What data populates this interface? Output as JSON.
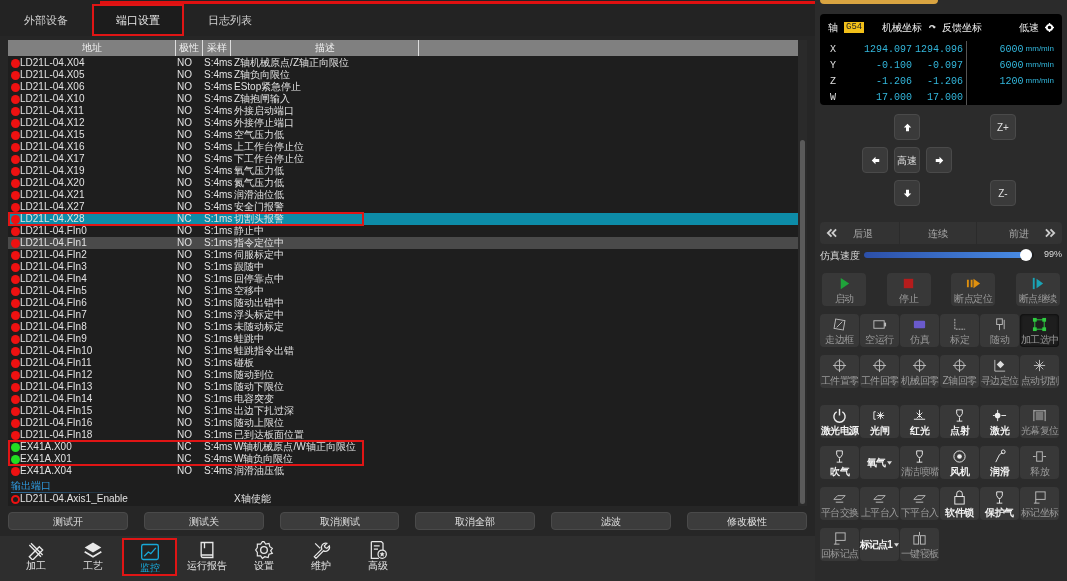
{
  "tabs": [
    {
      "label": "外部设备",
      "selected": false
    },
    {
      "label": "端口设置",
      "selected": true
    },
    {
      "label": "日志列表",
      "selected": false
    }
  ],
  "table": {
    "columns": [
      "地址",
      "极性",
      "采样",
      "描述"
    ],
    "rows": [
      {
        "kind": "input",
        "address": "LD21L-04.X04",
        "polarity": "NO",
        "sample": "S:4ms",
        "description": "Z轴机械原点/Z轴正向限位",
        "on": false,
        "selected": false,
        "hovered": false,
        "outlined": false
      },
      {
        "kind": "input",
        "address": "LD21L-04.X05",
        "polarity": "NO",
        "sample": "S:4ms",
        "description": "Z轴负向限位",
        "on": false,
        "selected": false,
        "hovered": false,
        "outlined": false
      },
      {
        "kind": "input",
        "address": "LD21L-04.X06",
        "polarity": "NO",
        "sample": "S:4ms",
        "description": "EStop紧急停止",
        "on": false,
        "selected": false,
        "hovered": false,
        "outlined": false
      },
      {
        "kind": "input",
        "address": "LD21L-04.X10",
        "polarity": "NO",
        "sample": "S:4ms",
        "description": "Z轴抱闸输入",
        "on": false,
        "selected": false,
        "hovered": false,
        "outlined": false
      },
      {
        "kind": "input",
        "address": "LD21L-04.X11",
        "polarity": "NO",
        "sample": "S:4ms",
        "description": "外接启动端口",
        "on": false,
        "selected": false,
        "hovered": false,
        "outlined": false
      },
      {
        "kind": "input",
        "address": "LD21L-04.X12",
        "polarity": "NO",
        "sample": "S:4ms",
        "description": "外接停止端口",
        "on": false,
        "selected": false,
        "hovered": false,
        "outlined": false
      },
      {
        "kind": "input",
        "address": "LD21L-04.X15",
        "polarity": "NO",
        "sample": "S:4ms",
        "description": "空气压力低",
        "on": false,
        "selected": false,
        "hovered": false,
        "outlined": false
      },
      {
        "kind": "input",
        "address": "LD21L-04.X16",
        "polarity": "NO",
        "sample": "S:4ms",
        "description": "上工作台停止位",
        "on": false,
        "selected": false,
        "hovered": false,
        "outlined": false
      },
      {
        "kind": "input",
        "address": "LD21L-04.X17",
        "polarity": "NO",
        "sample": "S:4ms",
        "description": "下工作台停止位",
        "on": false,
        "selected": false,
        "hovered": false,
        "outlined": false
      },
      {
        "kind": "input",
        "address": "LD21L-04.X19",
        "polarity": "NO",
        "sample": "S:4ms",
        "description": "氧气压力低",
        "on": false,
        "selected": false,
        "hovered": false,
        "outlined": false
      },
      {
        "kind": "input",
        "address": "LD21L-04.X20",
        "polarity": "NO",
        "sample": "S:4ms",
        "description": "氮气压力低",
        "on": false,
        "selected": false,
        "hovered": false,
        "outlined": false
      },
      {
        "kind": "input",
        "address": "LD21L-04.X21",
        "polarity": "NO",
        "sample": "S:4ms",
        "description": "润滑油位低",
        "on": false,
        "selected": false,
        "hovered": false,
        "outlined": false
      },
      {
        "kind": "input",
        "address": "LD21L-04.X27",
        "polarity": "NO",
        "sample": "S:4ms",
        "description": "安全门报警",
        "on": false,
        "selected": false,
        "hovered": false,
        "outlined": false
      },
      {
        "kind": "input",
        "address": "LD21L-04.X28",
        "polarity": "NC",
        "sample": "S:1ms",
        "description": "切割头报警",
        "on": false,
        "selected": true,
        "hovered": false,
        "outlined": true
      },
      {
        "kind": "input",
        "address": "LD21L-04.FIn0",
        "polarity": "NO",
        "sample": "S:1ms",
        "description": "静止中",
        "on": false,
        "selected": false,
        "hovered": false,
        "outlined": false
      },
      {
        "kind": "input",
        "address": "LD21L-04.FIn1",
        "polarity": "NO",
        "sample": "S:1ms",
        "description": "指令定位中",
        "on": false,
        "selected": false,
        "hovered": true,
        "outlined": false
      },
      {
        "kind": "input",
        "address": "LD21L-04.FIn2",
        "polarity": "NO",
        "sample": "S:1ms",
        "description": "伺服标定中",
        "on": false,
        "selected": false,
        "hovered": false,
        "outlined": false
      },
      {
        "kind": "input",
        "address": "LD21L-04.FIn3",
        "polarity": "NO",
        "sample": "S:1ms",
        "description": "跟随中",
        "on": false,
        "selected": false,
        "hovered": false,
        "outlined": false
      },
      {
        "kind": "input",
        "address": "LD21L-04.FIn4",
        "polarity": "NO",
        "sample": "S:1ms",
        "description": "回停靠点中",
        "on": false,
        "selected": false,
        "hovered": false,
        "outlined": false
      },
      {
        "kind": "input",
        "address": "LD21L-04.FIn5",
        "polarity": "NO",
        "sample": "S:1ms",
        "description": "空移中",
        "on": false,
        "selected": false,
        "hovered": false,
        "outlined": false
      },
      {
        "kind": "input",
        "address": "LD21L-04.FIn6",
        "polarity": "NO",
        "sample": "S:1ms",
        "description": "随动出错中",
        "on": false,
        "selected": false,
        "hovered": false,
        "outlined": false
      },
      {
        "kind": "input",
        "address": "LD21L-04.FIn7",
        "polarity": "NO",
        "sample": "S:1ms",
        "description": "浮头标定中",
        "on": false,
        "selected": false,
        "hovered": false,
        "outlined": false
      },
      {
        "kind": "input",
        "address": "LD21L-04.FIn8",
        "polarity": "NO",
        "sample": "S:1ms",
        "description": "未随动标定",
        "on": false,
        "selected": false,
        "hovered": false,
        "outlined": false
      },
      {
        "kind": "input",
        "address": "LD21L-04.FIn9",
        "polarity": "NO",
        "sample": "S:1ms",
        "description": "蛙跳中",
        "on": false,
        "selected": false,
        "hovered": false,
        "outlined": false
      },
      {
        "kind": "input",
        "address": "LD21L-04.FIn10",
        "polarity": "NO",
        "sample": "S:1ms",
        "description": "蛙跳指令出错",
        "on": false,
        "selected": false,
        "hovered": false,
        "outlined": false
      },
      {
        "kind": "input",
        "address": "LD21L-04.FIn11",
        "polarity": "NO",
        "sample": "S:1ms",
        "description": "碰板",
        "on": false,
        "selected": false,
        "hovered": false,
        "outlined": false
      },
      {
        "kind": "input",
        "address": "LD21L-04.FIn12",
        "polarity": "NO",
        "sample": "S:1ms",
        "description": "随动到位",
        "on": false,
        "selected": false,
        "hovered": false,
        "outlined": false
      },
      {
        "kind": "input",
        "address": "LD21L-04.FIn13",
        "polarity": "NO",
        "sample": "S:1ms",
        "description": "随动下限位",
        "on": false,
        "selected": false,
        "hovered": false,
        "outlined": false
      },
      {
        "kind": "input",
        "address": "LD21L-04.FIn14",
        "polarity": "NO",
        "sample": "S:1ms",
        "description": "电容突变",
        "on": false,
        "selected": false,
        "hovered": false,
        "outlined": false
      },
      {
        "kind": "input",
        "address": "LD21L-04.FIn15",
        "polarity": "NO",
        "sample": "S:1ms",
        "description": "出边下扎过深",
        "on": false,
        "selected": false,
        "hovered": false,
        "outlined": false
      },
      {
        "kind": "input",
        "address": "LD21L-04.FIn16",
        "polarity": "NO",
        "sample": "S:1ms",
        "description": "随动上限位",
        "on": false,
        "selected": false,
        "hovered": false,
        "outlined": false
      },
      {
        "kind": "input",
        "address": "LD21L-04.FIn18",
        "polarity": "NO",
        "sample": "S:1ms",
        "description": "已到达板面位置",
        "on": false,
        "selected": false,
        "hovered": false,
        "outlined": false
      },
      {
        "kind": "input",
        "address": "EX41A.X00",
        "polarity": "NC",
        "sample": "S:4ms",
        "description": "W轴机械原点/W轴正向限位",
        "on": true,
        "selected": false,
        "hovered": false,
        "outlined": true
      },
      {
        "kind": "input",
        "address": "EX41A.X01",
        "polarity": "NC",
        "sample": "S:4ms",
        "description": "W轴负向限位",
        "on": true,
        "selected": false,
        "hovered": false,
        "outlined": true
      },
      {
        "kind": "input",
        "address": "EX41A.X04",
        "polarity": "NO",
        "sample": "S:4ms",
        "description": "润滑油压低",
        "on": false,
        "selected": false,
        "hovered": false,
        "outlined": false
      },
      {
        "kind": "section",
        "label": "输出端口"
      },
      {
        "kind": "output",
        "address": "LD21L-04.Axis1_Enable",
        "description": "X轴使能",
        "on": false,
        "selected": false,
        "hovered": false,
        "outlined": false
      }
    ]
  },
  "actions": [
    "测试开",
    "测试关",
    "取消测试",
    "取消全部",
    "滤波",
    "修改极性"
  ],
  "nav": [
    {
      "label": "加工",
      "selected": false
    },
    {
      "label": "工艺",
      "selected": false
    },
    {
      "label": "监控",
      "selected": true
    },
    {
      "label": "运行报告",
      "selected": false
    },
    {
      "label": "设置",
      "selected": false
    },
    {
      "label": "维护",
      "selected": false
    },
    {
      "label": "高级",
      "selected": false
    }
  ],
  "dro": {
    "axis_label": "轴",
    "offset": "G54",
    "machine_label": "机械坐标",
    "feedback_label": "反馈坐标",
    "speed_mode": "低速",
    "rows": [
      {
        "axis": "X",
        "machine": "1294.097",
        "feedback": "1294.096",
        "speed": "6000",
        "unit": "mm/min"
      },
      {
        "axis": "Y",
        "machine": "-0.100",
        "feedback": "-0.097",
        "speed": "6000",
        "unit": "mm/min"
      },
      {
        "axis": "Z",
        "machine": "-1.206",
        "feedback": "-1.206",
        "speed": "1200",
        "unit": "mm/min"
      },
      {
        "axis": "W",
        "machine": "17.000",
        "feedback": "17.000"
      }
    ]
  },
  "jog": {
    "speed": "高速",
    "z_up": "Z+",
    "z_down": "Z-"
  },
  "step": {
    "back": "后退",
    "continuous": "连续",
    "forward": "前进"
  },
  "sim_speed": {
    "label": "仿真速度",
    "level": 0.99,
    "reading": "99%"
  },
  "button_groups": [
    {
      "buttons": [
        {
          "kind": "button",
          "label": "启动",
          "disabled": true,
          "on": false
        },
        {
          "kind": "button",
          "label": "停止",
          "disabled": true,
          "on": false
        },
        {
          "kind": "button",
          "label": "断点定位",
          "disabled": true,
          "on": false
        },
        {
          "kind": "button",
          "label": "断点继续",
          "disabled": true,
          "on": false
        }
      ]
    },
    {
      "buttons": [
        {
          "kind": "button",
          "label": "走边框",
          "disabled": true,
          "on": false
        },
        {
          "kind": "button",
          "label": "空运行",
          "disabled": true,
          "on": false
        },
        {
          "kind": "button",
          "label": "仿真",
          "disabled": true,
          "on": false
        },
        {
          "kind": "button",
          "label": "标定",
          "disabled": true,
          "on": false
        },
        {
          "kind": "button",
          "label": "随动",
          "disabled": true,
          "on": false
        },
        {
          "kind": "button",
          "label": "加工选中",
          "disabled": true,
          "on": true
        },
        {
          "kind": "button",
          "label": "工件置零",
          "disabled": true,
          "on": false
        },
        {
          "kind": "button",
          "label": "工件回零",
          "disabled": true,
          "on": false
        },
        {
          "kind": "button",
          "label": "机械回零",
          "disabled": true,
          "on": false
        },
        {
          "kind": "button",
          "label": "Z轴回零",
          "disabled": true,
          "on": false
        },
        {
          "kind": "button",
          "label": "寻边定位",
          "disabled": true,
          "on": false
        },
        {
          "kind": "button",
          "label": "点动切割",
          "disabled": true,
          "on": false
        }
      ]
    },
    {
      "buttons": [
        {
          "kind": "button",
          "label": "激光电源",
          "disabled": false,
          "on": false
        },
        {
          "kind": "button",
          "label": "光闸",
          "disabled": false,
          "on": false
        },
        {
          "kind": "button",
          "label": "红光",
          "disabled": false,
          "on": false
        },
        {
          "kind": "button",
          "label": "点射",
          "disabled": false,
          "on": false
        },
        {
          "kind": "button",
          "label": "激光",
          "disabled": false,
          "on": false
        },
        {
          "kind": "button",
          "label": "光幕复位",
          "disabled": true,
          "on": false
        },
        {
          "kind": "button",
          "label": "吹气",
          "disabled": false,
          "on": false
        },
        {
          "kind": "dropdown",
          "label": "氧气",
          "disabled": false,
          "on": false
        },
        {
          "kind": "button",
          "label": "清洁喷嘴",
          "disabled": true,
          "on": false
        },
        {
          "kind": "button",
          "label": "风机",
          "disabled": false,
          "on": false
        },
        {
          "kind": "button",
          "label": "润滑",
          "disabled": false,
          "on": false
        },
        {
          "kind": "button",
          "label": "释放",
          "disabled": true,
          "on": false
        },
        {
          "kind": "button",
          "label": "平台交换",
          "disabled": true,
          "on": false
        },
        {
          "kind": "button",
          "label": "上平台入",
          "disabled": true,
          "on": false
        },
        {
          "kind": "button",
          "label": "下平台入",
          "disabled": true,
          "on": false
        },
        {
          "kind": "button",
          "label": "软件锁",
          "disabled": false,
          "on": false
        },
        {
          "kind": "button",
          "label": "保护气",
          "disabled": false,
          "on": false
        },
        {
          "kind": "button",
          "label": "标记坐标",
          "disabled": true,
          "on": false
        },
        {
          "kind": "button",
          "label": "回标记点",
          "disabled": true,
          "on": false
        },
        {
          "kind": "dropdown",
          "label": "标记点1",
          "disabled": false,
          "on": false
        },
        {
          "kind": "button",
          "label": "一键寝板",
          "disabled": true,
          "on": false
        }
      ]
    }
  ]
}
